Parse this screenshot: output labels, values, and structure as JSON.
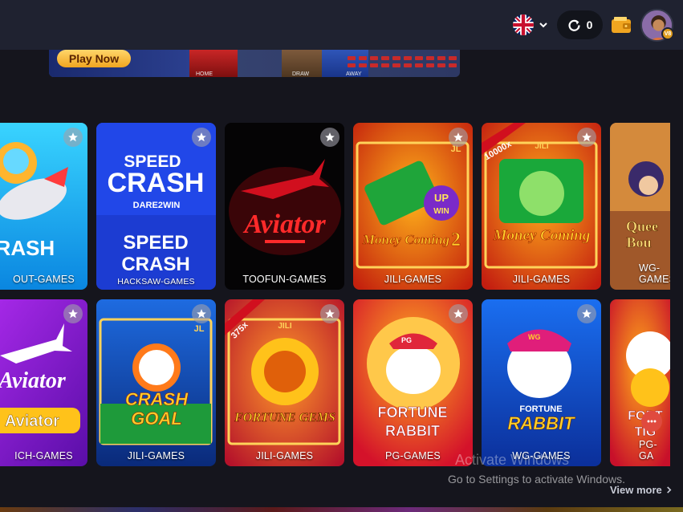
{
  "header": {
    "language_icon": "uk-flag-icon",
    "balance": "0",
    "wallet_icon": "wallet-icon",
    "vip_badge": "V8"
  },
  "banner": {
    "play_now": "Play Now",
    "home_label": "HOME",
    "draw_label": "DRAW",
    "away_label": "AWAY"
  },
  "games": [
    {
      "title": "CRASH",
      "provider": "OUT-GAMES"
    },
    {
      "title": "SPEED CRASH",
      "provider": "HACKSAW-GAMES"
    },
    {
      "title": "Aviator",
      "provider": "TOOFUN-GAMES"
    },
    {
      "title": "Money Coming 2",
      "provider": "JILI-GAMES"
    },
    {
      "title": "Money Coming",
      "provider": "JILI-GAMES"
    },
    {
      "title": "Queen Bounty",
      "provider": "WG-GAMES"
    },
    {
      "title": "Aviator",
      "provider": "ICH-GAMES"
    },
    {
      "title": "CRASH GOAL",
      "provider": "JILI-GAMES"
    },
    {
      "title": "FORTUNE GEMS",
      "provider": "JILI-GAMES"
    },
    {
      "title": "FORTUNE RABBIT",
      "provider": "PG-GAMES"
    },
    {
      "title": "FORTUNE RABBIT",
      "provider": "WG-GAMES"
    },
    {
      "title": "FORTUNE TIGER",
      "provider": "PG-GA"
    }
  ],
  "card_text": {
    "speed_crash_big": "SPEED",
    "speed_crash_big2": "CRASH",
    "speed_top1": "SPEED",
    "speed_top2": "CRASH",
    "dare2win": "DARE2WIN",
    "aviator": "Aviator",
    "money_coming": "Money Coming",
    "money_coming_2": "2",
    "up_win": "UP",
    "win": "WIN",
    "jili": "JILI",
    "jl": "JL",
    "x10000": "10000x",
    "x375": "375x",
    "crash_goal1": "CRASH",
    "crash_goal2": "GOAL",
    "fortune_gems": "FORTUNE GEMS",
    "fortune": "FORTUNE",
    "rabbit": "RABBIT",
    "wg": "WG",
    "pg": "PG",
    "queen": "Quee",
    "bounty": "Bou",
    "crash": "CRASH",
    "fortune_tiger1": "FORT",
    "fortune_tiger2": "TIG"
  },
  "system": {
    "activate_title": "Activate Windows",
    "activate_sub": "Go to Settings to activate Windows."
  },
  "view_more": "View more",
  "colors": {
    "background": "#15151d",
    "topbar": "#1f2230",
    "accent": "#f0a520"
  }
}
